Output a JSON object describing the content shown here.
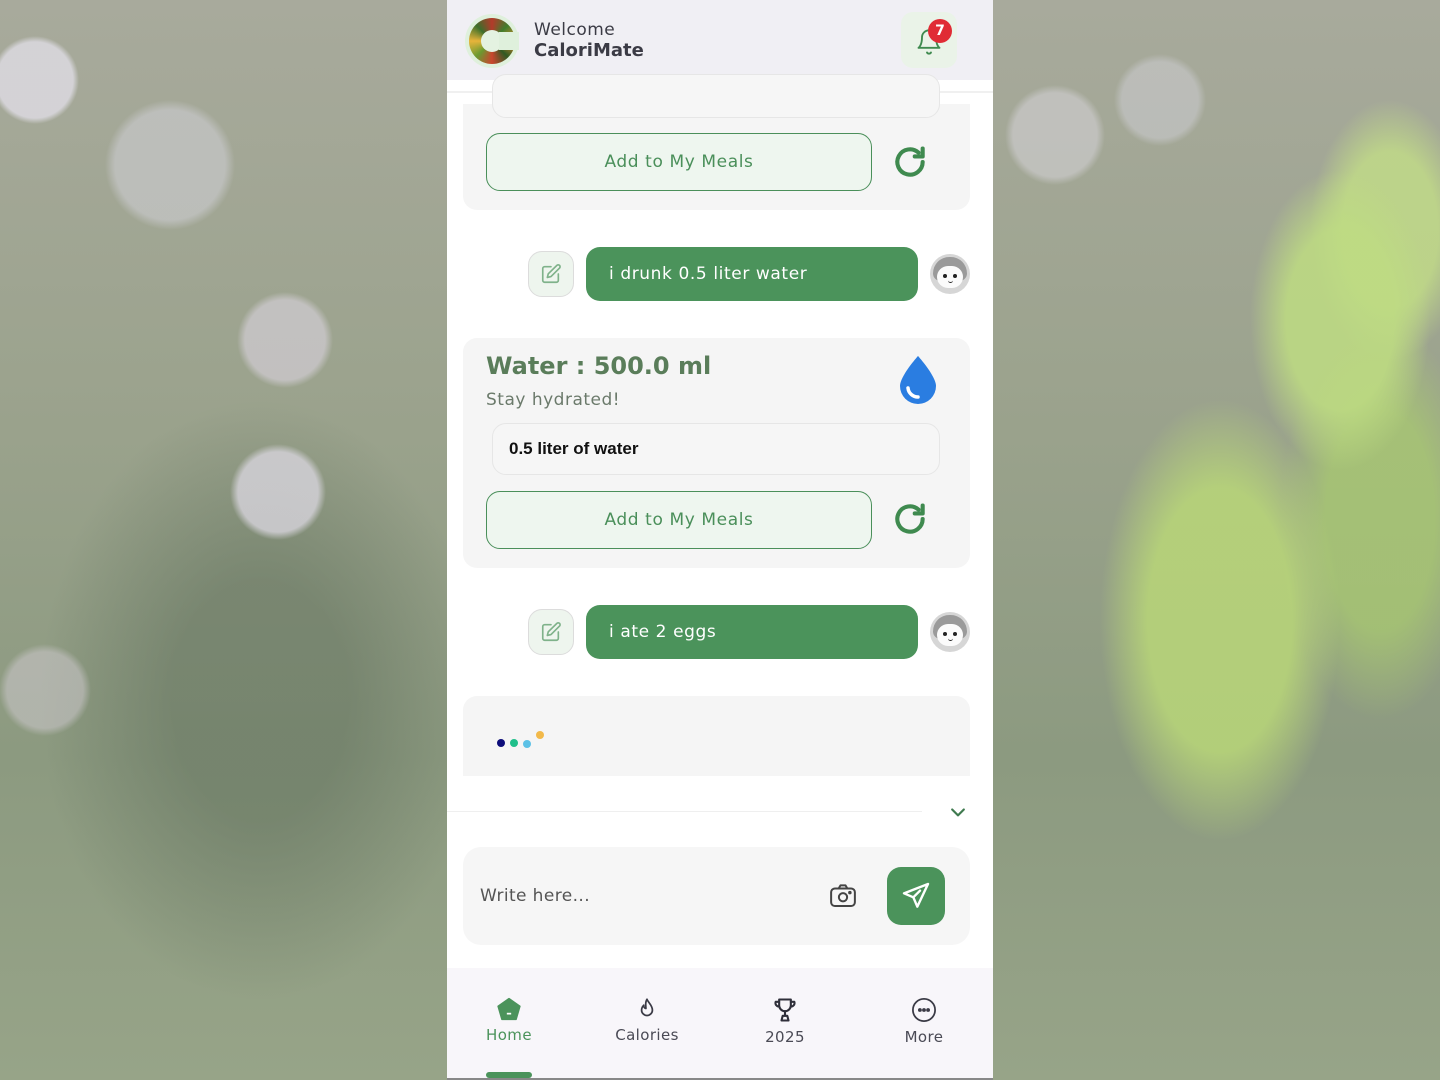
{
  "header": {
    "welcome": "Welcome",
    "app_name": "CaloriMate",
    "notification_count": "7",
    "logo_icon": "calorimate-logo",
    "bell_icon": "bell-icon"
  },
  "chat": {
    "top_card": {
      "add_button_label": "Add to My Meals",
      "refresh_icon": "refresh-icon"
    },
    "messages": [
      {
        "role": "user",
        "text": "i drunk 0.5 liter water"
      },
      {
        "role": "user",
        "text": "i ate 2 eggs"
      }
    ],
    "water_card": {
      "title": "Water : 500.0 ml",
      "subtitle": "Stay hydrated!",
      "item": "0.5 liter of water",
      "add_button_label": "Add to My Meals",
      "icon": "water-drop-icon"
    },
    "loading_indicator": {
      "dot_colors": [
        "#0d0d7a",
        "#1fbf8a",
        "#5cc1e6",
        "#f2b94a"
      ]
    }
  },
  "input": {
    "placeholder": "Write here...",
    "value": ""
  },
  "bottom_nav": {
    "items": [
      {
        "label": "Home",
        "icon": "home-icon",
        "active": true
      },
      {
        "label": "Calories",
        "icon": "flame-icon",
        "active": false
      },
      {
        "label": "2025",
        "icon": "trophy-icon",
        "active": false
      },
      {
        "label": "More",
        "icon": "more-icon",
        "active": false
      }
    ]
  },
  "colors": {
    "primary_green": "#4b935b",
    "badge_red": "#e02b35",
    "water_blue": "#2a7de1"
  }
}
